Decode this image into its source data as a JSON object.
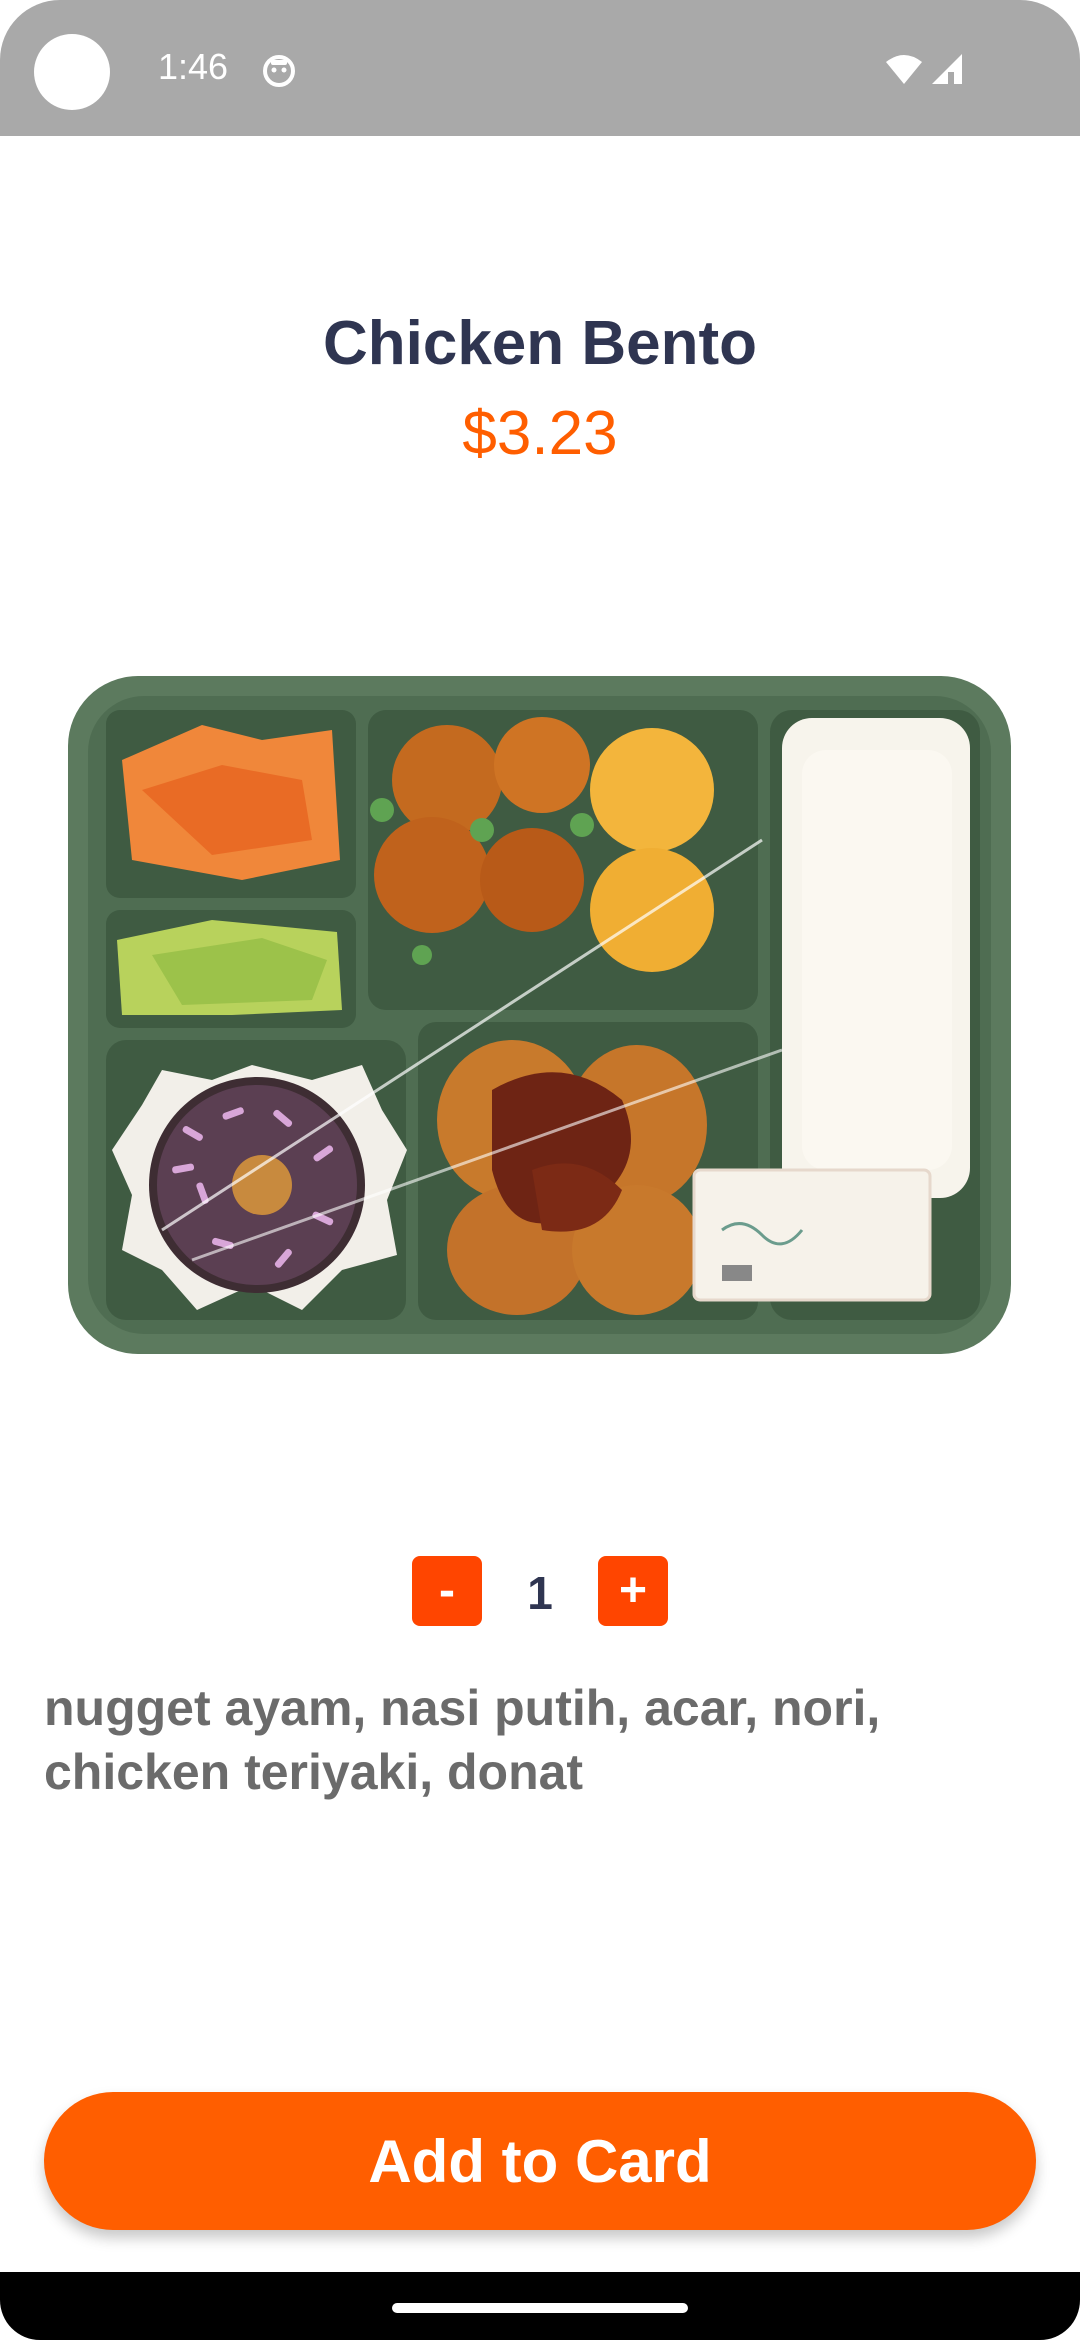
{
  "status_bar": {
    "time": "1:46"
  },
  "product": {
    "title": "Chicken Bento",
    "price": "$3.23",
    "image_alt": "Chicken bento box illustration"
  },
  "quantity": {
    "minus_label": "-",
    "value": "1",
    "plus_label": "+"
  },
  "description": "nugget ayam, nasi putih, acar, nori, chicken teriyaki, donat",
  "actions": {
    "add_label": "Add to Card"
  },
  "colors": {
    "accent": "#ff5e00",
    "stepper": "#ff4500",
    "title": "#2f3551",
    "tray": "#5c7a5e"
  }
}
